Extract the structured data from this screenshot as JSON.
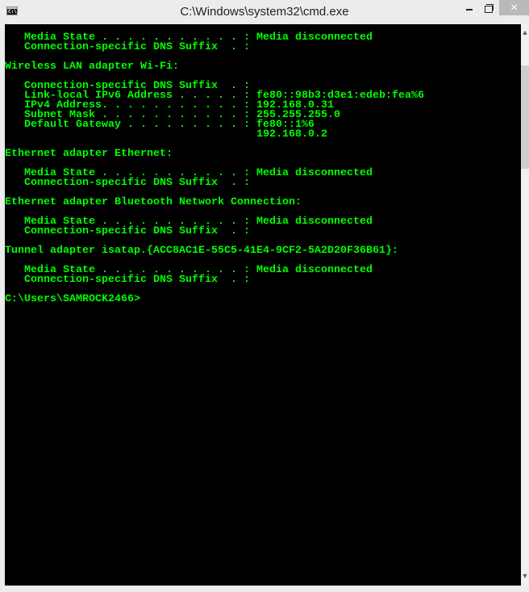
{
  "window": {
    "title": "C:\\Windows\\system32\\cmd.exe",
    "icon": "cmd-prompt-icon",
    "icon_text": "C:\\_",
    "controls": {
      "minimize": "minimize-icon",
      "restore": "restore-icon",
      "close": "×"
    }
  },
  "colors": {
    "console_background": "#000000",
    "console_text": "#00ff00",
    "titlebar": "#ececec",
    "close_button": "#b9b9b9"
  },
  "scrollbar": {
    "up_arrow": "▲",
    "down_arrow": "▼"
  },
  "console": {
    "lines": [
      "   Media State . . . . . . . . . . . : Media disconnected",
      "   Connection-specific DNS Suffix  . :",
      "",
      "Wireless LAN adapter Wi-Fi:",
      "",
      "   Connection-specific DNS Suffix  . :",
      "   Link-local IPv6 Address . . . . . : fe80::98b3:d3e1:edeb:fea%6",
      "   IPv4 Address. . . . . . . . . . . : 192.168.0.31",
      "   Subnet Mask . . . . . . . . . . . : 255.255.255.0",
      "   Default Gateway . . . . . . . . . : fe80::1%6",
      "                                       192.168.0.2",
      "",
      "Ethernet adapter Ethernet:",
      "",
      "   Media State . . . . . . . . . . . : Media disconnected",
      "   Connection-specific DNS Suffix  . :",
      "",
      "Ethernet adapter Bluetooth Network Connection:",
      "",
      "   Media State . . . . . . . . . . . : Media disconnected",
      "   Connection-specific DNS Suffix  . :",
      "",
      "Tunnel adapter isatap.{ACC8AC1E-55C5-41E4-9CF2-5A2D20F36B61}:",
      "",
      "   Media State . . . . . . . . . . . : Media disconnected",
      "   Connection-specific DNS Suffix  . :",
      "",
      "C:\\Users\\SAMROCK2466>"
    ]
  }
}
